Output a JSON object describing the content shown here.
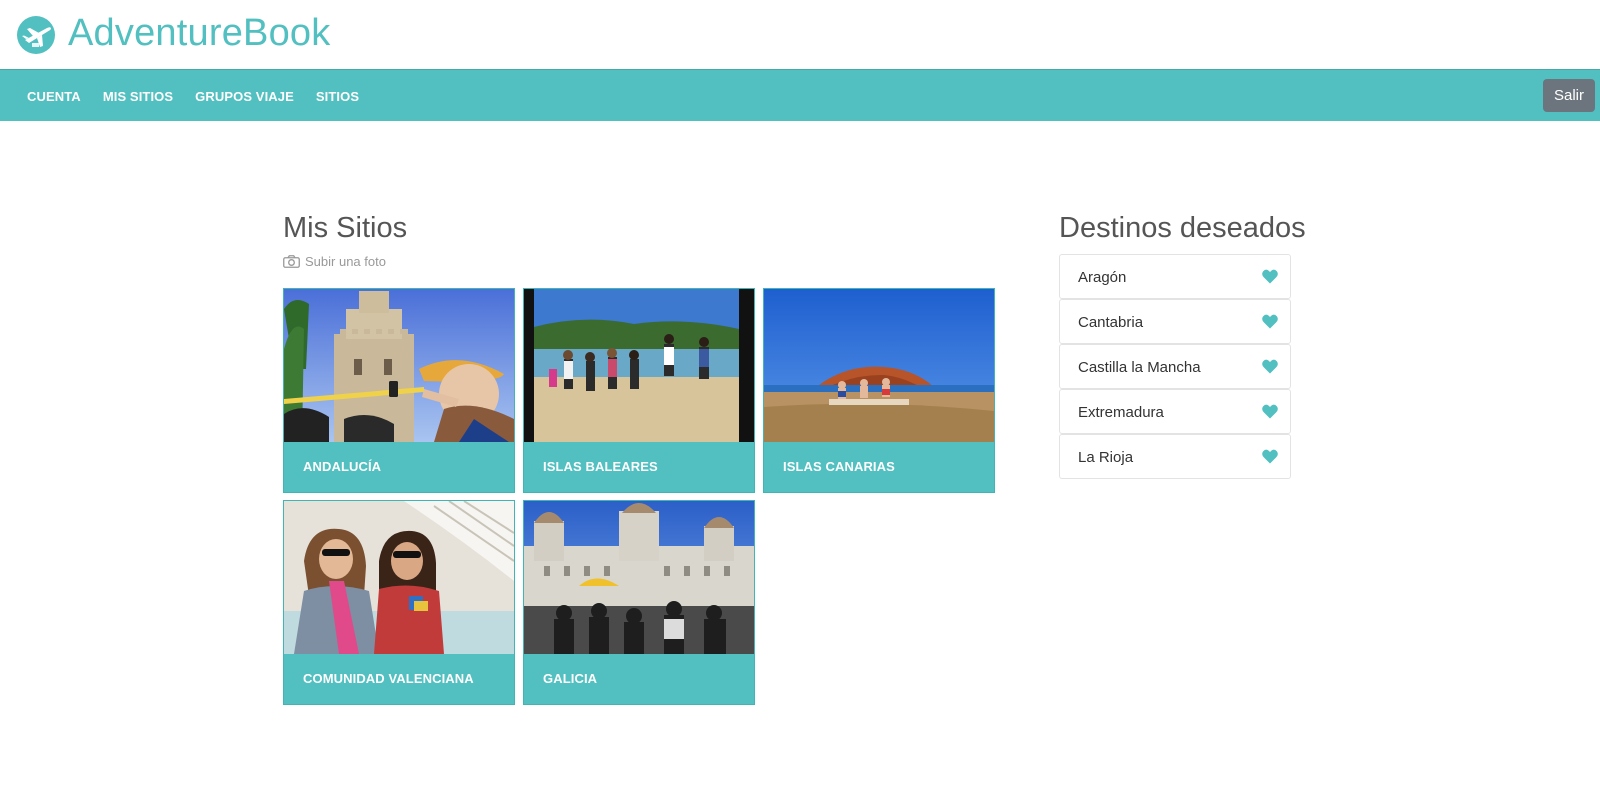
{
  "brand": {
    "title": "AdventureBook",
    "icon": "plane-icon"
  },
  "nav": {
    "items": [
      "CUENTA",
      "MIS SITIOS",
      "GRUPOS VIAJE",
      "SITIOS"
    ],
    "logout_label": "Salir"
  },
  "my_places": {
    "title": "Mis Sitios",
    "upload_label": "Subir una foto",
    "upload_icon": "camera-icon",
    "cards": [
      {
        "label": "ANDALUCÍA",
        "photo": "photo-torre-del-oro"
      },
      {
        "label": "ISLAS BALEARES",
        "photo": "photo-group-beach-jump"
      },
      {
        "label": "ISLAS CANARIAS",
        "photo": "photo-beach-red-mountain"
      },
      {
        "label": "COMUNIDAD VALENCIANA",
        "photo": "photo-two-women-selfie"
      },
      {
        "label": "GALICIA",
        "photo": "photo-city-square"
      }
    ]
  },
  "wishlist": {
    "title": "Destinos deseados",
    "items": [
      "Aragón",
      "Cantabria",
      "Castilla la Mancha",
      "Extremadura",
      "La Rioja"
    ],
    "icon": "heart-icon"
  },
  "colors": {
    "accent": "#52bfc0",
    "logout": "#6c757d",
    "text": "#555555"
  }
}
